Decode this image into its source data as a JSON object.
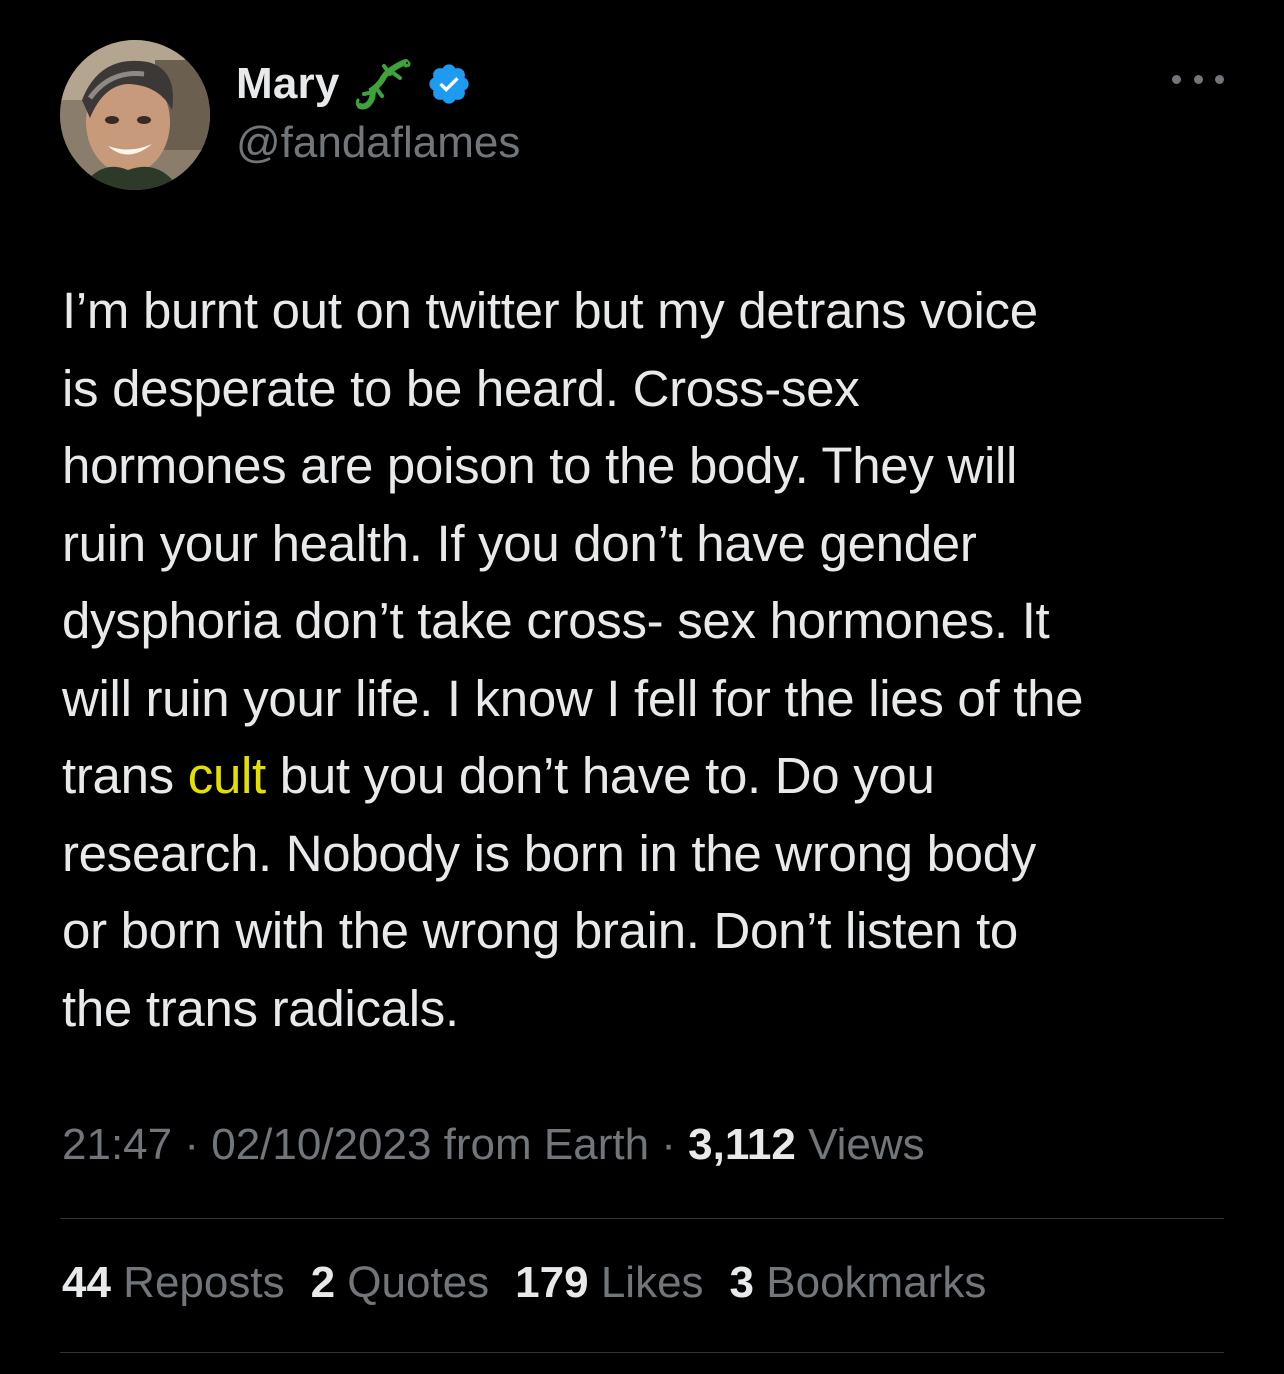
{
  "author": {
    "display_name": "Mary",
    "handle": "@fandaflames",
    "badge_emoji": "lizard-icon",
    "verified": true
  },
  "tweet": {
    "text_before": "I’m burnt out on twitter but my detrans voice\nis desperate to be heard. Cross-sex\nhormones are poison to the body. They will\nruin your health. If you don’t have gender\ndysphoria don’t take cross- sex hormones. It\nwill ruin your life. I know I fell for the lies of the\ntrans ",
    "highlight_word": "cult",
    "text_after": " but you don’t have to. Do you\nresearch. Nobody is born in the wrong body\nor born with the wrong brain. Don’t listen to\nthe trans radicals."
  },
  "meta": {
    "time": "21:47",
    "separator": " · ",
    "date": "02/10/2023",
    "source": " from Earth",
    "views_count": "3,112",
    "views_label": " Views"
  },
  "stats": [
    {
      "count": "44",
      "label": " Reposts"
    },
    {
      "count": "2",
      "label": " Quotes"
    },
    {
      "count": "179",
      "label": " Likes"
    },
    {
      "count": "3",
      "label": " Bookmarks"
    }
  ],
  "colors": {
    "background": "#000000",
    "primary_text": "#e7e9ea",
    "secondary_text": "#71767b",
    "verified_blue": "#1d9bf0",
    "highlight": "#e3e000",
    "divider": "#2f3336"
  }
}
